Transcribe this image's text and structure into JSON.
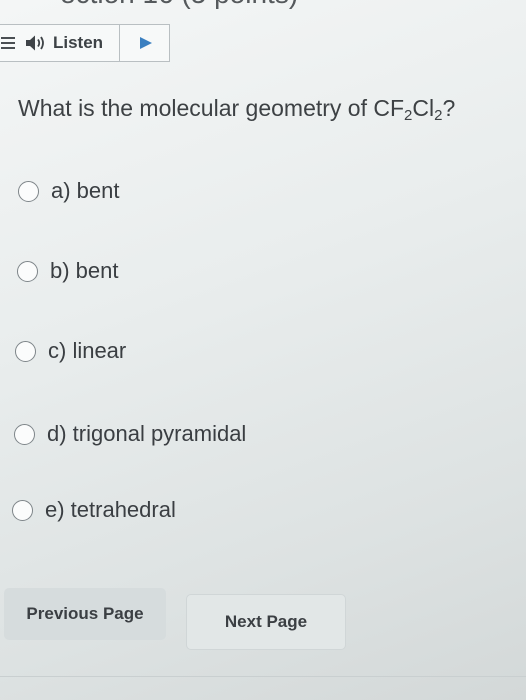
{
  "header": {
    "cut_title": "ection 16 (5 points)"
  },
  "toolbar": {
    "listen_label": "Listen"
  },
  "question": {
    "prefix": "What is the molecular geometry of CF",
    "sub1": "2",
    "mid": "Cl",
    "sub2": "2",
    "suffix": "?"
  },
  "options": [
    {
      "label": "a) bent"
    },
    {
      "label": "b) bent"
    },
    {
      "label": "c) linear"
    },
    {
      "label": "d) trigonal pyramidal"
    },
    {
      "label": "e) tetrahedral"
    }
  ],
  "navigation": {
    "previous_label": "Previous Page",
    "next_label": "Next Page"
  }
}
